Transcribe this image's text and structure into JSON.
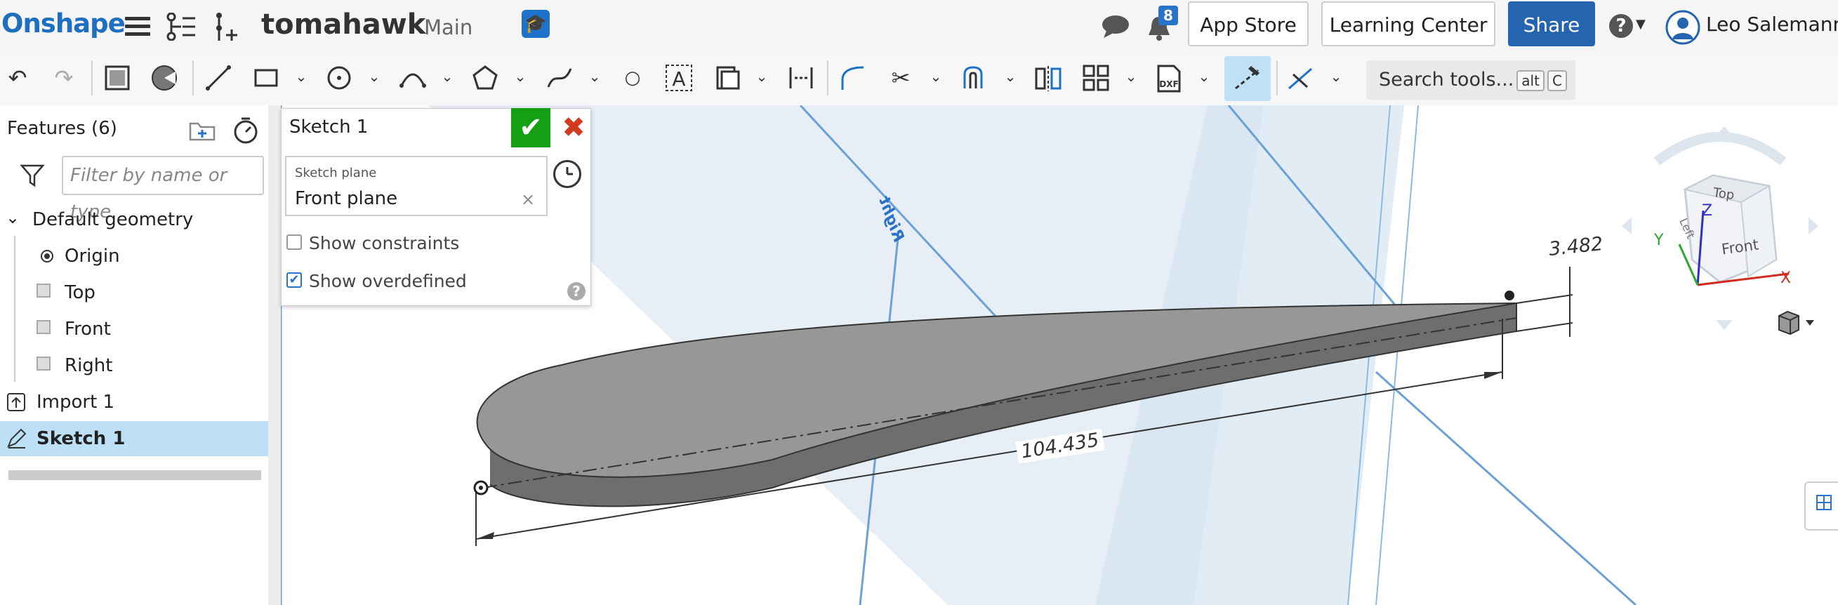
{
  "app": {
    "logo": "Onshape",
    "document_title": "tomahawk",
    "workspace": "Main",
    "notifications_count": "8",
    "app_store_label": "App Store",
    "learning_center_label": "Learning Center",
    "share_label": "Share",
    "user_name": "Leo Salemann"
  },
  "toolbar": {
    "search_label": "Search tools...",
    "shortcut_key1": "alt",
    "shortcut_key2": "C"
  },
  "features": {
    "title": "Features (6)",
    "filter_placeholder": "Filter by name or type",
    "default_geometry_label": "Default geometry",
    "items": [
      "Origin",
      "Top",
      "Front",
      "Right",
      "Import 1",
      "Sketch 1"
    ]
  },
  "sketch_dialog": {
    "title": "Sketch 1",
    "plane_caption": "Sketch plane",
    "plane_value": "Front plane",
    "clear_symbol": "×",
    "show_constraints_label": "Show constraints",
    "show_constraints_checked": false,
    "show_overdefined_label": "Show overdefined",
    "show_overdefined_checked": true,
    "help_symbol": "?"
  },
  "viewport": {
    "dimension_length": "104.435",
    "dimension_thickness": "3.482",
    "right_plane_label": "Right",
    "view_cube": {
      "top_label": "Top",
      "front_label": "Front",
      "left_label": "Left",
      "axis_x": "X",
      "axis_y": "Y",
      "axis_z": "Z"
    }
  },
  "colors": {
    "brand": "#1f6fc1",
    "share_button": "#2565b0",
    "accept": "#13a015",
    "cancel": "#d23a1f",
    "selected_row": "#bde0f7",
    "part_gray": "#7b7b7b"
  }
}
